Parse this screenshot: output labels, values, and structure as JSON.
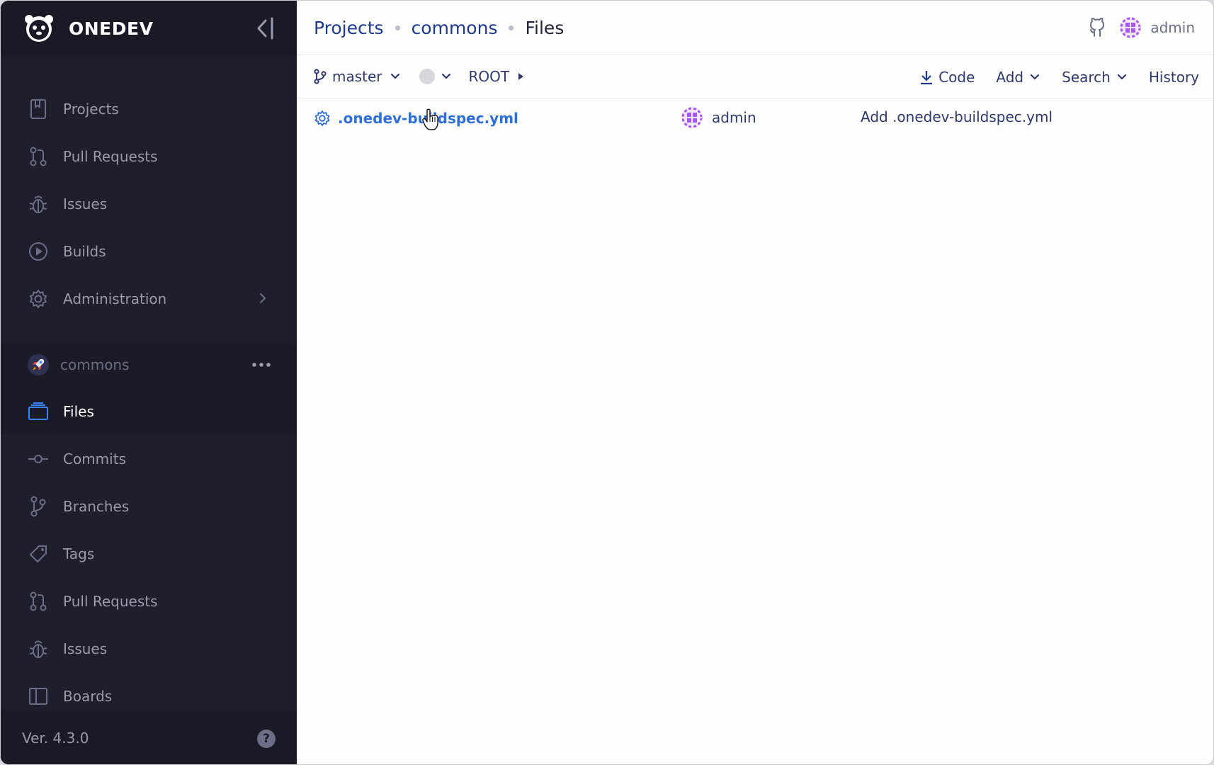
{
  "brand": {
    "name": "ONEDEV"
  },
  "sidebar": {
    "main_items": [
      {
        "label": "Projects",
        "icon": "projects-icon"
      },
      {
        "label": "Pull Requests",
        "icon": "pull-request-icon"
      },
      {
        "label": "Issues",
        "icon": "bug-icon"
      },
      {
        "label": "Builds",
        "icon": "play-circle-icon"
      },
      {
        "label": "Administration",
        "icon": "gear-icon"
      }
    ],
    "project": {
      "name": "commons"
    },
    "project_items": [
      {
        "label": "Files",
        "icon": "files-icon",
        "active": true
      },
      {
        "label": "Commits",
        "icon": "commit-icon"
      },
      {
        "label": "Branches",
        "icon": "branch-icon"
      },
      {
        "label": "Tags",
        "icon": "tag-icon"
      },
      {
        "label": "Pull Requests",
        "icon": "pull-request-icon"
      },
      {
        "label": "Issues",
        "icon": "bug-icon"
      },
      {
        "label": "Boards",
        "icon": "board-icon"
      }
    ],
    "version": "Ver. 4.3.0",
    "help_symbol": "?"
  },
  "topbar": {
    "breadcrumbs": [
      "Projects",
      "commons",
      "Files"
    ],
    "user": "admin"
  },
  "toolbar": {
    "branch": "master",
    "path_root": "ROOT",
    "code_label": "Code",
    "add_label": "Add",
    "search_label": "Search",
    "history_label": "History"
  },
  "files": [
    {
      "name": ".onedev-buildspec.yml",
      "author": "admin",
      "message": "Add .onedev-buildspec.yml"
    }
  ],
  "colors": {
    "sidebar_bg": "#1e1e2d",
    "link_blue": "#2f6fd6",
    "breadcrumb_blue": "#1e3a8a",
    "files_icon_blue": "#3b82f6",
    "avatar_purple": "#a855f7"
  }
}
